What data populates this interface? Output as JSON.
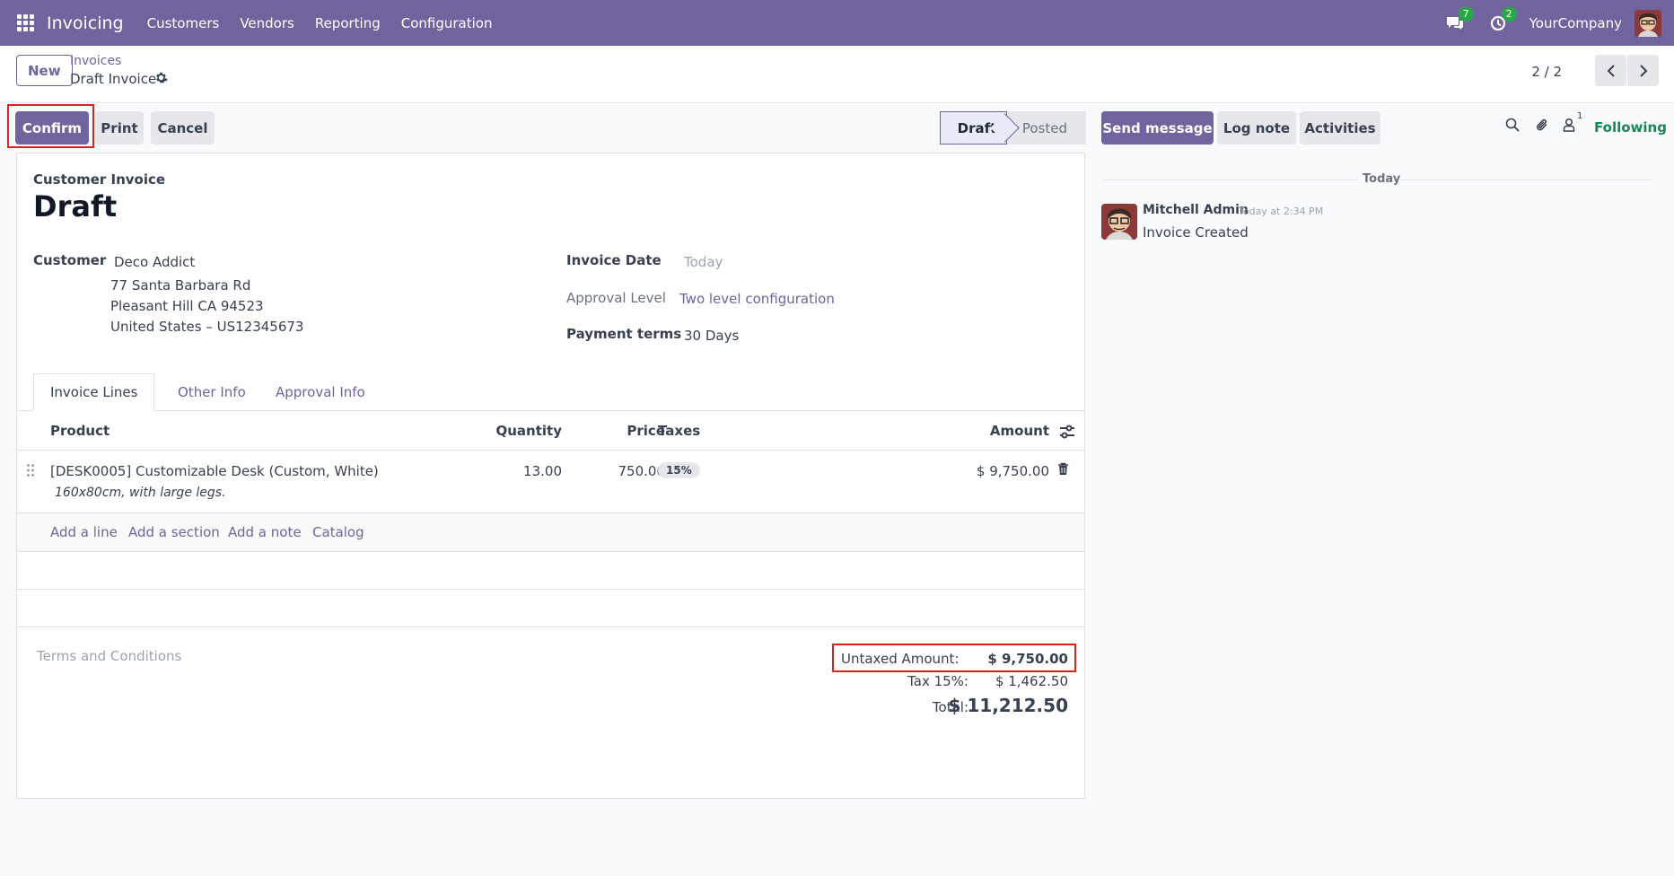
{
  "topbar": {
    "app_name": "Invoicing",
    "menu": [
      "Customers",
      "Vendors",
      "Reporting",
      "Configuration"
    ],
    "messages_count": "7",
    "activities_count": "2",
    "company": "YourCompany"
  },
  "control_panel": {
    "new_label": "New",
    "breadcrumb_parent": "Invoices",
    "breadcrumb_current": "Draft Invoice",
    "pager": "2 / 2"
  },
  "actions": {
    "confirm": "Confirm",
    "print": "Print",
    "cancel": "Cancel"
  },
  "status": {
    "stages": [
      "Draft",
      "Posted"
    ],
    "current": "Draft"
  },
  "form": {
    "type_label": "Customer Invoice",
    "title": "Draft",
    "customer_label": "Customer",
    "customer_name": "Deco Addict",
    "address_line1": "77 Santa Barbara Rd",
    "address_line2": "Pleasant Hill CA 94523",
    "address_line3": "United States – US12345673",
    "invoice_date_label": "Invoice Date",
    "invoice_date_placeholder": "Today",
    "approval_level_label": "Approval Level",
    "approval_level_value": "Two level configuration",
    "payment_terms_label": "Payment terms",
    "payment_terms_value": "30 Days"
  },
  "tabs": [
    "Invoice Lines",
    "Other Info",
    "Approval Info"
  ],
  "lines": {
    "headers": {
      "product": "Product",
      "quantity": "Quantity",
      "price": "Price",
      "taxes": "Taxes",
      "amount": "Amount"
    },
    "rows": [
      {
        "product": "[DESK0005] Customizable Desk (Custom, White)",
        "description": "160x80cm, with large legs.",
        "quantity": "13.00",
        "price": "750.00",
        "tax": "15%",
        "amount": "$ 9,750.00"
      }
    ],
    "add_line": "Add a line",
    "add_section": "Add a section",
    "add_note": "Add a note",
    "catalog": "Catalog"
  },
  "terms_placeholder": "Terms and Conditions",
  "totals": {
    "untaxed_label": "Untaxed Amount:",
    "untaxed_value": "$ 9,750.00",
    "tax_label": "Tax 15%:",
    "tax_value": "$ 1,462.50",
    "total_label": "Total:",
    "total_value": "$ 11,212.50"
  },
  "chatter": {
    "send_message": "Send message",
    "log_note": "Log note",
    "activities": "Activities",
    "followers_count": "1",
    "following": "Following",
    "date_separator": "Today",
    "author": "Mitchell Admin",
    "timestamp": "Today at 2:34 PM",
    "message": "Invoice Created"
  },
  "colors": {
    "brand": "#71639e",
    "following": "#198754",
    "highlight": "#e01f1f"
  }
}
